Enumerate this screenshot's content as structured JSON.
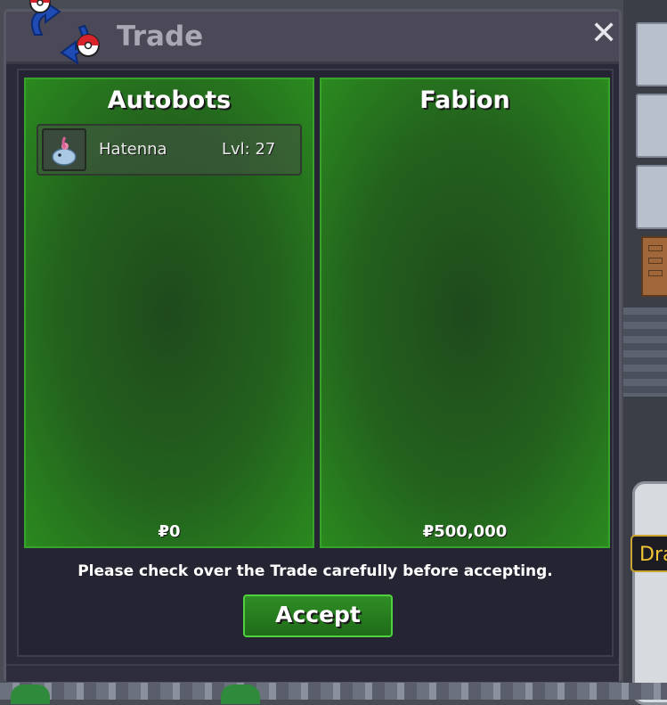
{
  "window": {
    "title": "Trade",
    "close_label": "✕"
  },
  "left_panel": {
    "player_name": "Autobots",
    "money": "₽0",
    "pokemon": [
      {
        "name": "Hatenna",
        "level": "Lvl: 27"
      }
    ]
  },
  "right_panel": {
    "player_name": "Fabion",
    "money": "₽500,000"
  },
  "notice": "Please check over the Trade carefully before accepting.",
  "accept_label": "Accept",
  "background": {
    "tooltip_text": "Dra"
  },
  "colors": {
    "panel_green": "#2a8a1f",
    "accept_green": "#2f8e25",
    "window_bg": "#2b2a3a"
  }
}
